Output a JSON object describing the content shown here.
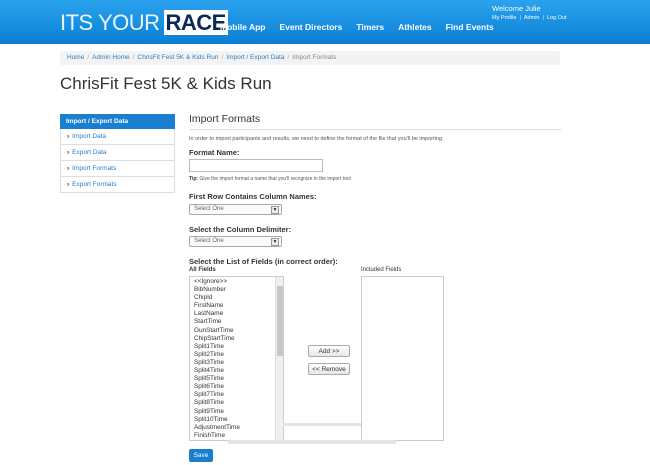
{
  "header": {
    "logo_thin": "ITS YOUR",
    "logo_bold": "RACE",
    "nav": [
      "Mobile App",
      "Event Directors",
      "Timers",
      "Athletes",
      "Find Events"
    ],
    "welcome": "Welcome Julie",
    "user_links": [
      "My Profile",
      "Admin",
      "Log Out"
    ]
  },
  "breadcrumb": {
    "items": [
      "Home",
      "Admin Home",
      "ChrisFit Fest 5K & Kids Run",
      "Import / Export Data"
    ],
    "current": "Import Formats"
  },
  "page_title": "ChrisFit Fest 5K & Kids Run",
  "sidebar": {
    "heading": "Import / Export Data",
    "items": [
      "Import Data",
      "Export Data",
      "Import Formats",
      "Export Formats"
    ]
  },
  "form": {
    "section_title": "Import Formats",
    "intro": "In order to import participants and results, we need to define the format of the file that you'll be importing.",
    "format_name_label": "Format Name:",
    "format_name_value": "",
    "tip_label": "Tip:",
    "tip_text": "Give the import format a name that you'll recognize in the import tool",
    "first_row_label": "First Row Contains Column Names:",
    "first_row_value": "Select One",
    "delimiter_label": "Select the Column Delimiter:",
    "delimiter_value": "Select One",
    "fields_label": "Select the List of Fields (in correct order):",
    "all_fields_label": "All Fields",
    "included_fields_label": "Included Fields",
    "all_fields": [
      "<<Ignore>>",
      "BibNumber",
      "ChipId",
      "FirstName",
      "LastName",
      "StartTime",
      "GunStartTime",
      "ChipStartTime",
      "Split1Time",
      "Split2Time",
      "Split3Time",
      "Split4Time",
      "Split5Time",
      "Split6Time",
      "Split7Time",
      "Split8Time",
      "Split9Time",
      "Split10Time",
      "AdjustmentTime",
      "FinishTime"
    ],
    "add_button": "Add >>",
    "remove_button": "<< Remove",
    "save_button": "Save"
  }
}
